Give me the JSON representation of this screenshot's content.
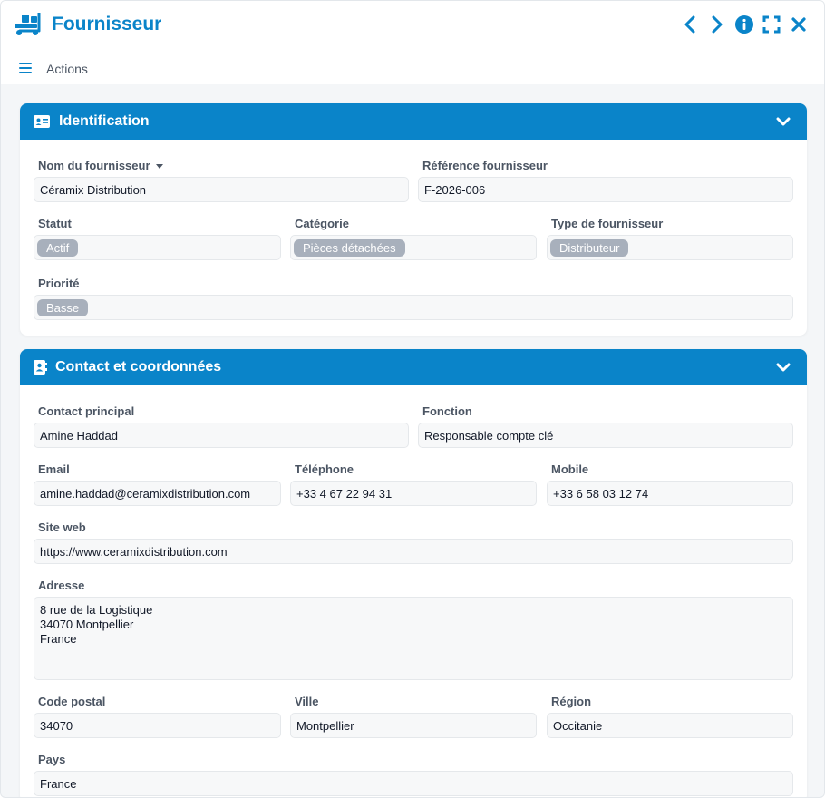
{
  "window": {
    "title": "Fournisseur",
    "app_icon": "truck-dolly-icon",
    "actions": [
      "chevron-left-icon",
      "chevron-right-icon",
      "info-icon",
      "expand-icon",
      "close-icon"
    ]
  },
  "toolbar": {
    "menu_icon": "hamburger-icon",
    "actions_label": "Actions"
  },
  "colors": {
    "accent": "#0a84c9",
    "tag": "#a8b0bc"
  },
  "identification": {
    "title": "Identification",
    "icon": "id-card-icon",
    "nom_label": "Nom du fournisseur",
    "nom_value": "Céramix Distribution",
    "ref_label": "Référence fournisseur",
    "ref_value": "F-2026-006",
    "statut_label": "Statut",
    "statut_value": "Actif",
    "categorie_label": "Catégorie",
    "categorie_value": "Pièces détachées",
    "type_label": "Type de fournisseur",
    "type_value": "Distributeur",
    "priorite_label": "Priorité",
    "priorite_value": "Basse"
  },
  "contact": {
    "title": "Contact et coordonnées",
    "icon": "contact-book-icon",
    "contact_label": "Contact principal",
    "contact_value": "Amine Haddad",
    "fonction_label": "Fonction",
    "fonction_value": "Responsable compte clé",
    "email_label": "Email",
    "email_value": "amine.haddad@ceramixdistribution.com",
    "telephone_label": "Téléphone",
    "telephone_value": "+33 4 67 22 94 31",
    "mobile_label": "Mobile",
    "mobile_value": "+33 6 58 03 12 74",
    "site_label": "Site web",
    "site_value": "https://www.ceramixdistribution.com",
    "adresse_label": "Adresse",
    "adresse_value": "8 rue de la Logistique\n34070 Montpellier\nFrance",
    "cp_label": "Code postal",
    "cp_value": "34070",
    "ville_label": "Ville",
    "ville_value": "Montpellier",
    "region_label": "Région",
    "region_value": "Occitanie",
    "pays_label": "Pays",
    "pays_value": "France"
  }
}
